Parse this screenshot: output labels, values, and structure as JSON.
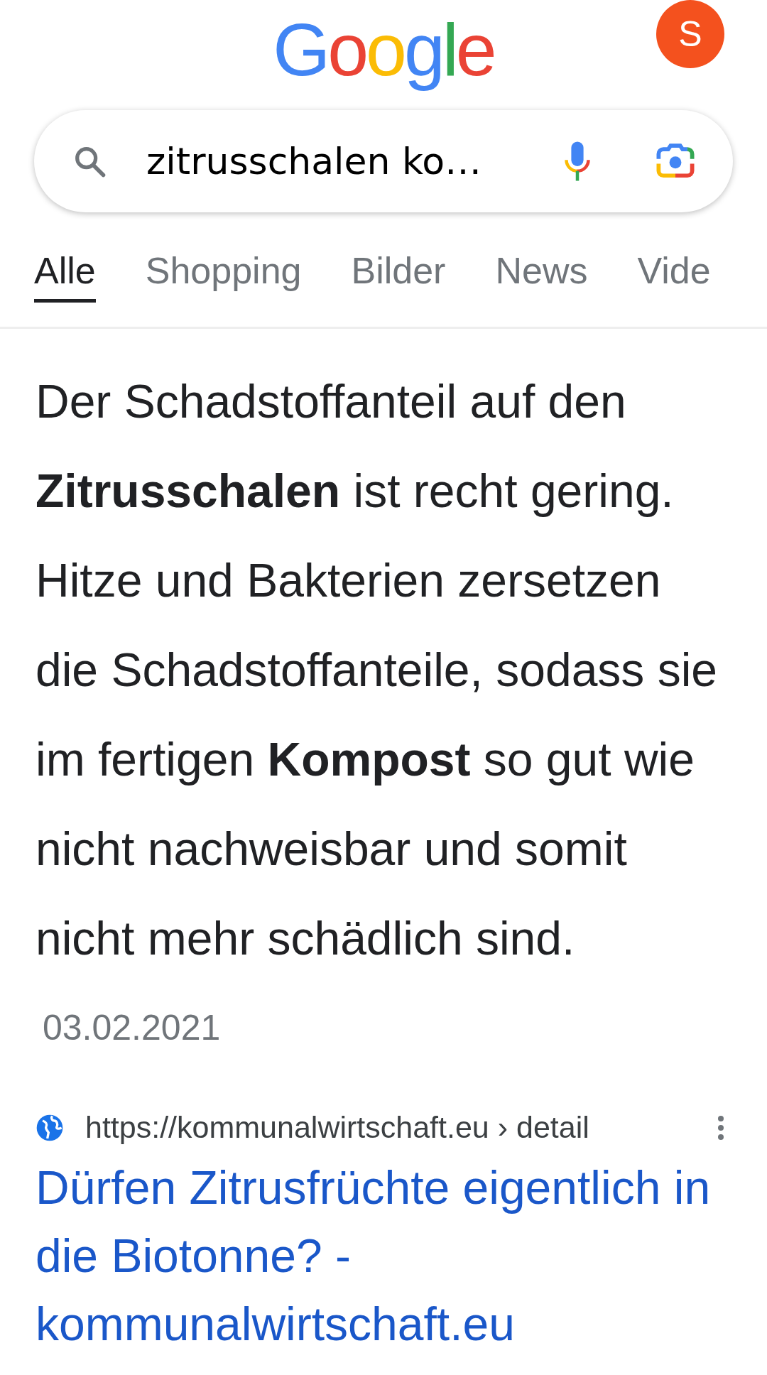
{
  "header": {
    "logo": "Google",
    "avatar": "S"
  },
  "search": {
    "value": "zitrusschalen ko…"
  },
  "tabs": [
    {
      "label": "Alle",
      "selected": true
    },
    {
      "label": "Shopping",
      "selected": false
    },
    {
      "label": "Bilder",
      "selected": false
    },
    {
      "label": "News",
      "selected": false
    },
    {
      "label": "Vide",
      "selected": false
    }
  ],
  "snippet": {
    "text": "Der Schadstoffanteil auf den **Zitrusschalen** ist recht gering. Hitze und Bakterien zersetzen die Schadstoffanteile, sodass sie im fertigen **Kompost** so gut wie nicht nachweisbar und somit nicht mehr schädlich sind.",
    "date": "03.02.2021"
  },
  "result": {
    "url": "https://kommunalwirtschaft.eu › detail",
    "title": "Dürfen Zitrusfrüchte eigentlich in die Biotonne? - kommunalwirtschaft.eu"
  }
}
